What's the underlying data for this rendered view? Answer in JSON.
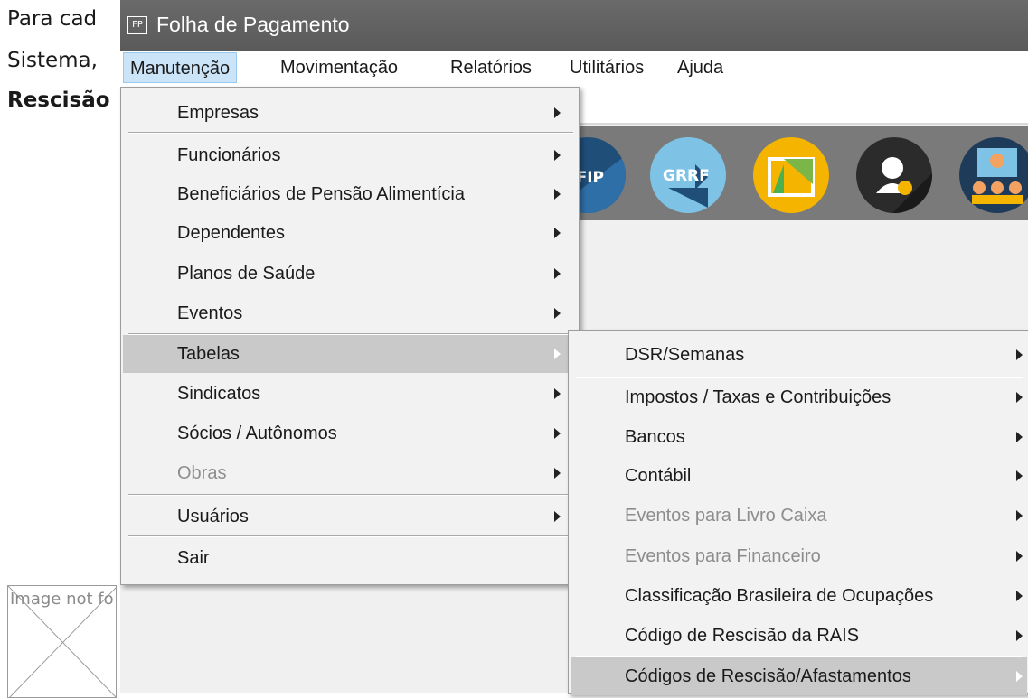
{
  "document": {
    "line1": "Para cad",
    "line2": "Sistema,",
    "line3": "Rescisão",
    "broken_image_alt": "Image not fo"
  },
  "window": {
    "icon_text": "FP",
    "title": "Folha de Pagamento"
  },
  "menubar": [
    {
      "label": "Manutenção"
    },
    {
      "label": "Movimentação"
    },
    {
      "label": "Relatórios"
    },
    {
      "label": "Utilitários"
    },
    {
      "label": "Ajuda"
    }
  ],
  "toolbar": {
    "icons": [
      {
        "name": "sefip-icon",
        "text": "EFIP",
        "color": "#1f4e79"
      },
      {
        "name": "grrf-icon",
        "text": "GRRF",
        "color": "#7ec3e6"
      },
      {
        "name": "document-icon",
        "text": "",
        "color": "#f4b400"
      },
      {
        "name": "support-icon",
        "text": "",
        "color": "#2b2b2b"
      },
      {
        "name": "users-icon",
        "text": "",
        "color": "#1f3b5a"
      }
    ]
  },
  "manutencao_menu": [
    {
      "label": "Empresas"
    },
    {
      "label": "Funcionários"
    },
    {
      "label": "Beneficiários de Pensão Alimentícia"
    },
    {
      "label": "Dependentes"
    },
    {
      "label": "Planos de Saúde"
    },
    {
      "label": "Eventos"
    },
    {
      "label": "Tabelas"
    },
    {
      "label": "Sindicatos"
    },
    {
      "label": "Sócios / Autônomos"
    },
    {
      "label": "Obras"
    },
    {
      "label": "Usuários"
    },
    {
      "label": "Sair"
    }
  ],
  "tabelas_submenu": [
    {
      "label": "DSR/Semanas"
    },
    {
      "label": "Impostos / Taxas e Contribuições"
    },
    {
      "label": "Bancos"
    },
    {
      "label": "Contábil"
    },
    {
      "label": "Eventos para Livro Caixa"
    },
    {
      "label": "Eventos para Financeiro"
    },
    {
      "label": "Classificação Brasileira de Ocupações"
    },
    {
      "label": "Código de Rescisão da RAIS"
    },
    {
      "label": "Códigos de Rescisão/Afastamentos"
    }
  ],
  "colors": {
    "titlebar": "#5f5f5f",
    "toolbar": "#7a7a7a",
    "menu_highlight": "#c9c9c9",
    "menubar_active": "#cce4f7"
  }
}
